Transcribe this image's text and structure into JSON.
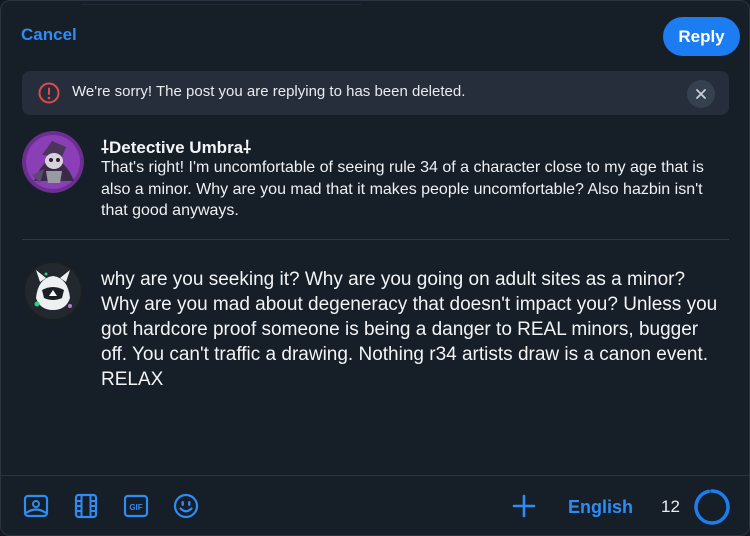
{
  "header": {
    "cancel_label": "Cancel",
    "reply_label": "Reply"
  },
  "notice": {
    "text": "We're sorry! The post you are replying to has been deleted.",
    "warn_icon": "alert-circle-icon",
    "close_icon": "close-icon"
  },
  "parent_post": {
    "author": "⸸Detective Umbra⸸",
    "text": "That's right! I'm uncomfortable of seeing rule 34 of a character close to my age that is also a minor. Why are you mad that it makes people uncomfortable? Also hazbin isn't that good anyways."
  },
  "draft": {
    "text": "why are you seeking it? Why are you going on adult sites as a minor? Why are you mad about degeneracy that doesn't impact you? Unless you got hardcore proof someone is being a danger to REAL minors, bugger off. You can't traffic a drawing. Nothing r34 artists draw is a canon event. RELAX"
  },
  "toolbar": {
    "icons": [
      "image-icon",
      "video-icon",
      "gif-icon",
      "emoji-icon",
      "plus-icon"
    ],
    "language": "English",
    "remaining_count": "12",
    "char_usage_fraction": 0.96
  },
  "colors": {
    "accent": "#1c7cf2",
    "link": "#2f8cf5",
    "background": "#161e27",
    "warning": "#e5484d"
  }
}
